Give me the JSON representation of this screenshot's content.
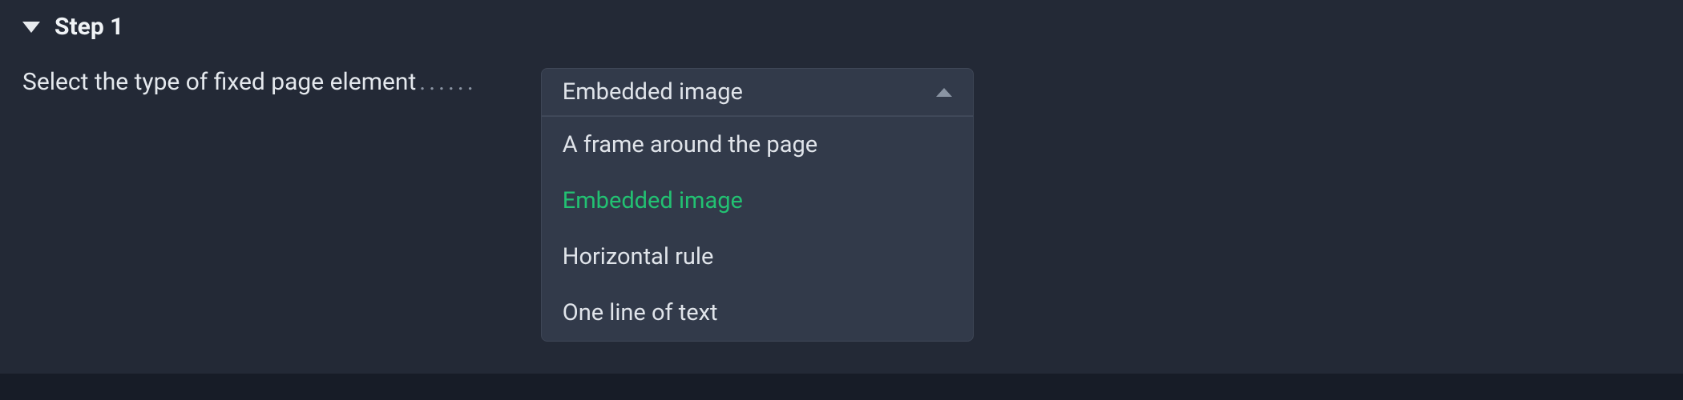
{
  "step": {
    "title": "Step 1",
    "field_label": "Select the type of fixed page element",
    "dots": "......"
  },
  "dropdown": {
    "selected": "Embedded image",
    "options": [
      {
        "label": "A frame around the page",
        "active": false
      },
      {
        "label": "Embedded image",
        "active": true
      },
      {
        "label": "Horizontal rule",
        "active": false
      },
      {
        "label": "One line of text",
        "active": false
      }
    ]
  }
}
